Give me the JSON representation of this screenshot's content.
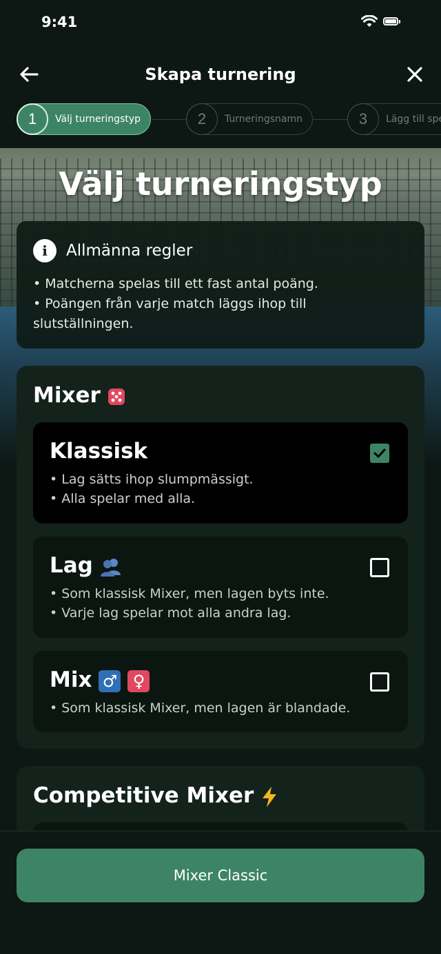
{
  "status": {
    "time": "9:41"
  },
  "header": {
    "title": "Skapa turnering"
  },
  "stepper": {
    "steps": [
      {
        "number": "1",
        "label": "Välj turneringstyp"
      },
      {
        "number": "2",
        "label": "Turneringsnamn"
      },
      {
        "number": "3",
        "label": "Lägg till spelare"
      }
    ]
  },
  "hero": {
    "title": "Välj turneringstyp"
  },
  "rules": {
    "title": "Allmänna regler",
    "lines": [
      "• Matcherna spelas till ett fast antal poäng.",
      "• Poängen från varje match läggs ihop till",
      "slutställningen."
    ]
  },
  "mixer": {
    "title": "Mixer",
    "emoji": "dice-icon",
    "options": [
      {
        "title": "Klassisk",
        "checked": true,
        "lines": [
          "• Lag sätts ihop slumpmässigt.",
          "• Alla spelar med alla."
        ]
      },
      {
        "title": "Lag",
        "checked": false,
        "lines": [
          "• Som klassisk Mixer, men lagen byts inte.",
          "• Varje lag spelar mot alla andra lag."
        ]
      },
      {
        "title": "Mix",
        "checked": false,
        "lines": [
          "• Som klassisk Mixer, men lagen är blandade."
        ],
        "male_symbol": "♂",
        "female_symbol": "♀"
      }
    ]
  },
  "competitive": {
    "title": "Competitive Mixer",
    "emoji": "lightning-icon"
  },
  "cta": {
    "label": "Mixer Classic"
  },
  "colors": {
    "accent": "#3d8466",
    "background": "#0d1713",
    "card": "#13221b",
    "male": "#2f6fb7",
    "female": "#e0485f"
  }
}
